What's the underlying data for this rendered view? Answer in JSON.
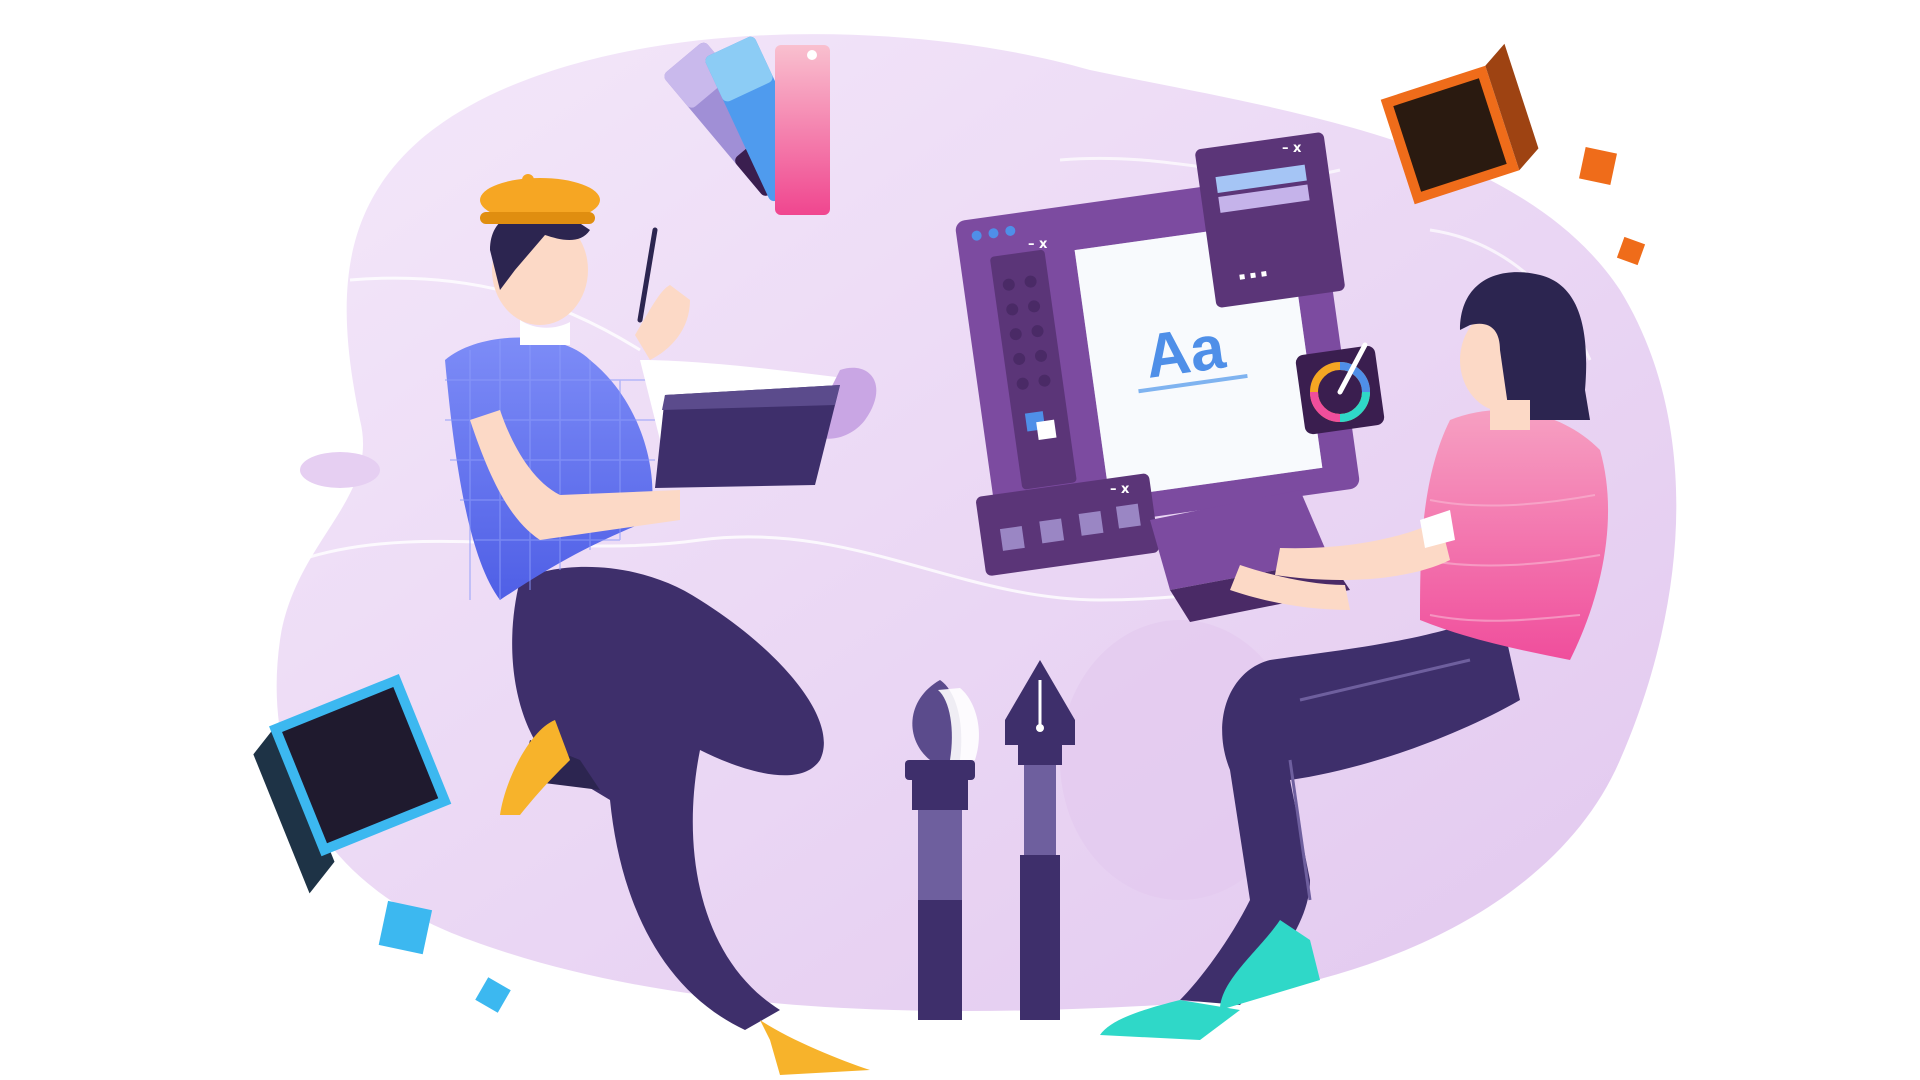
{
  "illustration": {
    "typography_sample": "Aa",
    "window_controls": "– x"
  },
  "palette": {
    "background_blob": "#EEDDF6",
    "background_blob_inner": "#E4CBF0",
    "window_purple": "#7C4BA0",
    "window_dark": "#5B3578",
    "accent_blue": "#4F8FE8",
    "pants": "#3E2F6B",
    "shirt_blue": "#6C7CF5",
    "shirt_pink": "#F46CA8",
    "hat_yellow": "#F6A623",
    "shoe_yellow": "#F7B32B",
    "shoe_teal": "#2FD8C8",
    "skin": "#FCD9C6",
    "hair": "#2C2550",
    "cube_orange": "#EF6C1A",
    "cube_blue": "#3CB8F0"
  },
  "icons": [
    "color-swatch-icon",
    "brush-icon",
    "fountain-pen-icon",
    "color-wheel-icon",
    "layers-icon",
    "cube-icon",
    "drawing-tablet-icon",
    "laptop-icon"
  ]
}
